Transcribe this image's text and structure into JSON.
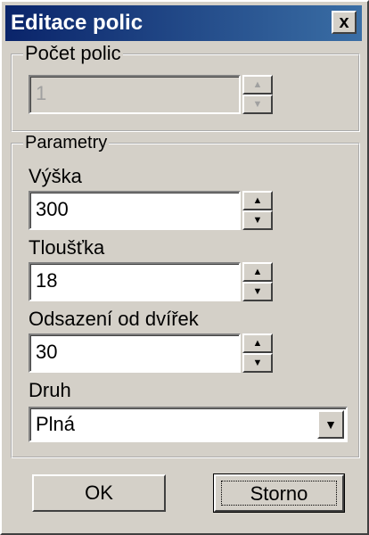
{
  "window": {
    "title": "Editace polic",
    "close_glyph": "x"
  },
  "count_group": {
    "legend": "Počet polic",
    "value": "1",
    "disabled": true
  },
  "params_group": {
    "legend": "Parametry",
    "height": {
      "label": "Výška",
      "value": "300"
    },
    "thickness": {
      "label": "Tloušťka",
      "value": "18"
    },
    "offset": {
      "label": "Odsazení od dvířek",
      "value": "30"
    },
    "type": {
      "label": "Druh",
      "selected": "Plná"
    }
  },
  "buttons": {
    "ok": "OK",
    "cancel": "Storno"
  },
  "colors": {
    "titlebar_start": "#0a246a",
    "titlebar_end": "#3a6ea5",
    "face": "#d4d0c8"
  },
  "icons": {
    "spin_up": "up-arrow-icon",
    "spin_down": "down-arrow-icon",
    "dropdown": "chevron-down-icon",
    "close": "close-icon"
  }
}
